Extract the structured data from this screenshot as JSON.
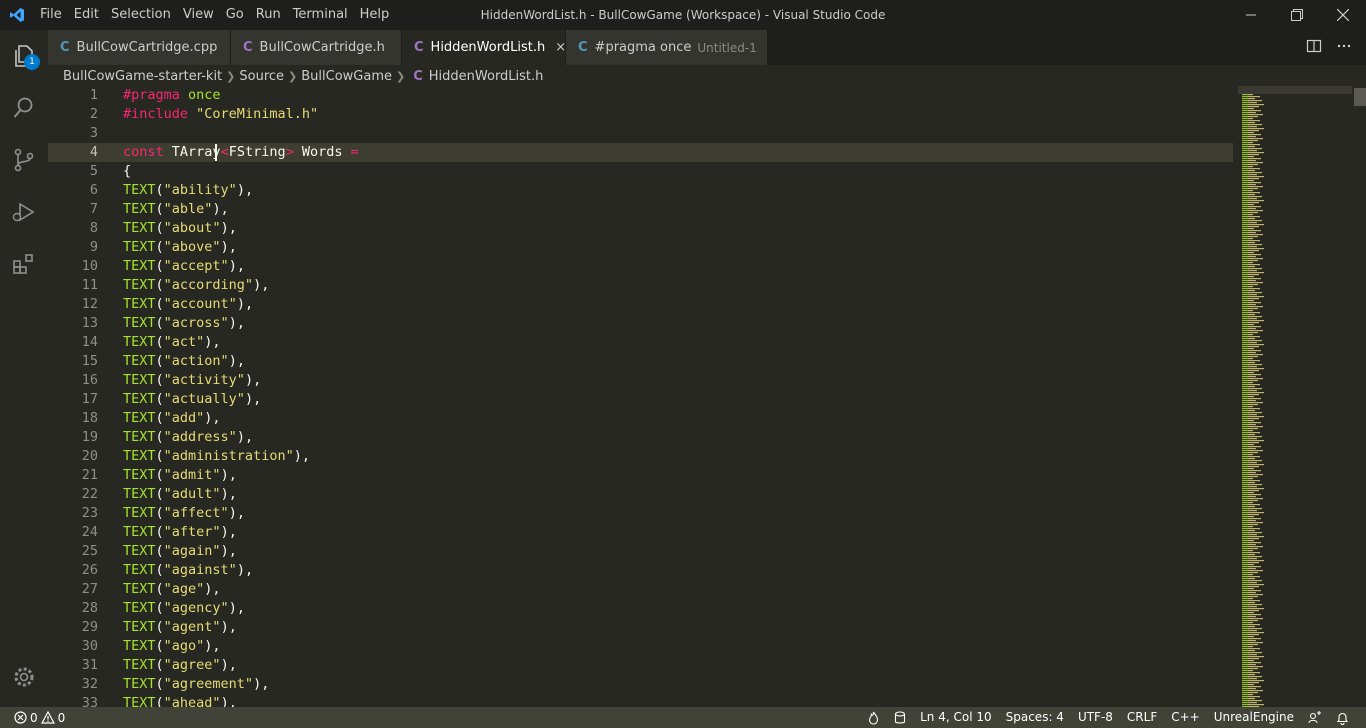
{
  "titlebar": {
    "menu": [
      "File",
      "Edit",
      "Selection",
      "View",
      "Go",
      "Run",
      "Terminal",
      "Help"
    ],
    "window_title": "HiddenWordList.h - BullCowGame (Workspace) - Visual Studio Code"
  },
  "activity": {
    "explorer_badge": "1"
  },
  "tabs": [
    {
      "icon": "C",
      "type": "cpp",
      "label": "BullCowCartridge.cpp"
    },
    {
      "icon": "C",
      "type": "h",
      "label": "BullCowCartridge.h"
    },
    {
      "icon": "C",
      "type": "h",
      "label": "HiddenWordList.h",
      "close": "×"
    },
    {
      "icon": "C",
      "type": "cpp",
      "label": "#pragma once",
      "sub": "Untitled-1"
    }
  ],
  "breadcrumb": [
    "BullCowGame-starter-kit",
    "Source",
    "BullCowGame",
    "HiddenWordList.h"
  ],
  "code": {
    "pragma_kw": "#pragma",
    "pragma_arg": "once",
    "include_kw": "#include",
    "include_str": "\"CoreMinimal.h\"",
    "decl_const": "const",
    "decl_type": "TArray",
    "decl_lt": "<",
    "decl_inner": "FString",
    "decl_gt": ">",
    "decl_name": " Words ",
    "decl_eq": "=",
    "open_brace": "{",
    "macro": "TEXT",
    "words": [
      "ability",
      "able",
      "about",
      "above",
      "accept",
      "according",
      "account",
      "across",
      "act",
      "action",
      "activity",
      "actually",
      "add",
      "address",
      "administration",
      "admit",
      "adult",
      "affect",
      "after",
      "again",
      "against",
      "age",
      "agency",
      "agent",
      "ago",
      "agree",
      "agreement",
      "ahead"
    ]
  },
  "status": {
    "errors": "0",
    "warnings": "0",
    "position": "Ln 4, Col 10",
    "spaces": "Spaces: 4",
    "encoding": "UTF-8",
    "eol": "CRLF",
    "language": "C++",
    "config": "UnrealEngine"
  },
  "colors": {
    "accent": "#007acc",
    "keyword": "#f92672",
    "function": "#a6e22e",
    "string": "#e6db74"
  }
}
